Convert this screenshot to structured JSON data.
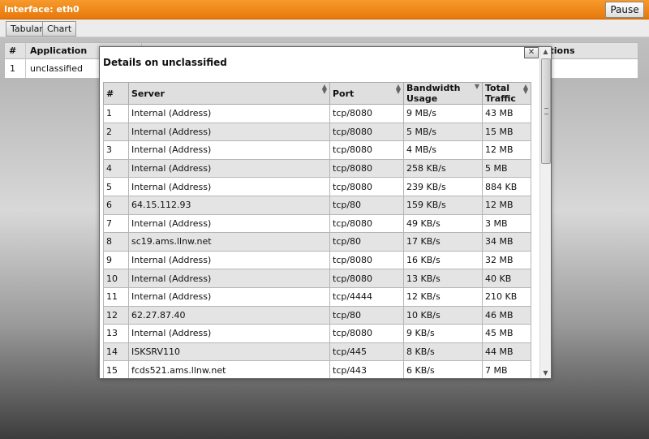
{
  "header": {
    "title": "Interface: eth0",
    "pause_label": "Pause"
  },
  "tabs": [
    {
      "label": "Tabular"
    },
    {
      "label": "Chart"
    }
  ],
  "background_table": {
    "columns": [
      "#",
      "Application",
      "ctions"
    ],
    "rows": [
      {
        "num": "1",
        "application": "unclassified"
      }
    ]
  },
  "modal": {
    "title": "Details on unclassified",
    "close_label": "✕",
    "columns": [
      "#",
      "Server",
      "Port",
      "Bandwidth Usage",
      "Total Traffic"
    ],
    "rows": [
      {
        "num": "1",
        "server": "Internal (Address)",
        "port": "tcp/8080",
        "bandwidth": "9 MB/s",
        "traffic": "43 MB"
      },
      {
        "num": "2",
        "server": "Internal (Address)",
        "port": "tcp/8080",
        "bandwidth": "5 MB/s",
        "traffic": "15 MB"
      },
      {
        "num": "3",
        "server": "Internal (Address)",
        "port": "tcp/8080",
        "bandwidth": "4 MB/s",
        "traffic": "12 MB"
      },
      {
        "num": "4",
        "server": "Internal (Address)",
        "port": "tcp/8080",
        "bandwidth": "258 KB/s",
        "traffic": "5 MB"
      },
      {
        "num": "5",
        "server": "Internal (Address)",
        "port": "tcp/8080",
        "bandwidth": "239 KB/s",
        "traffic": "884 KB"
      },
      {
        "num": "6",
        "server": "64.15.112.93",
        "port": "tcp/80",
        "bandwidth": "159 KB/s",
        "traffic": "12 MB"
      },
      {
        "num": "7",
        "server": "Internal (Address)",
        "port": "tcp/8080",
        "bandwidth": "49 KB/s",
        "traffic": "3 MB"
      },
      {
        "num": "8",
        "server": "sc19.ams.llnw.net",
        "port": "tcp/80",
        "bandwidth": "17 KB/s",
        "traffic": "34 MB"
      },
      {
        "num": "9",
        "server": "Internal (Address)",
        "port": "tcp/8080",
        "bandwidth": "16 KB/s",
        "traffic": "32 MB"
      },
      {
        "num": "10",
        "server": "Internal (Address)",
        "port": "tcp/8080",
        "bandwidth": "13 KB/s",
        "traffic": "40 KB"
      },
      {
        "num": "11",
        "server": "Internal (Address)",
        "port": "tcp/4444",
        "bandwidth": "12 KB/s",
        "traffic": "210 KB"
      },
      {
        "num": "12",
        "server": "62.27.87.40",
        "port": "tcp/80",
        "bandwidth": "10 KB/s",
        "traffic": "46 MB"
      },
      {
        "num": "13",
        "server": "Internal (Address)",
        "port": "tcp/8080",
        "bandwidth": "9 KB/s",
        "traffic": "45 MB"
      },
      {
        "num": "14",
        "server": "ISKSRV110",
        "port": "tcp/445",
        "bandwidth": "8 KB/s",
        "traffic": "44 MB"
      },
      {
        "num": "15",
        "server": "fcds521.ams.llnw.net",
        "port": "tcp/443",
        "bandwidth": "6 KB/s",
        "traffic": "7 MB"
      },
      {
        "num": "",
        "server": "",
        "port": "",
        "bandwidth": "",
        "traffic": ""
      }
    ]
  },
  "colors": {
    "titlebar": "#f0871a",
    "row_alt": "#e4e4e4"
  }
}
